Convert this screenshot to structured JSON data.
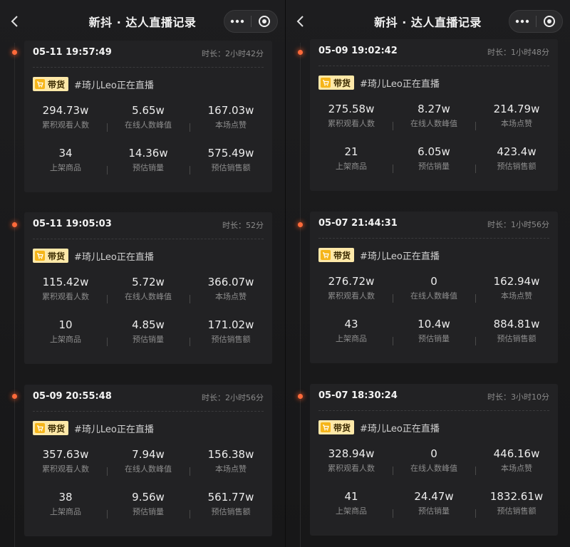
{
  "screens": [
    {
      "title": "新抖 · 达人直播记录",
      "cards": [
        {
          "time": "05-11 19:57:49",
          "duration": "时长：2小时42分",
          "tag": "带货",
          "hashtag": "#琦儿Leo正在直播",
          "stats": [
            {
              "value": "294.73w",
              "label": "累积观看人数"
            },
            {
              "value": "5.65w",
              "label": "在线人数峰值"
            },
            {
              "value": "167.03w",
              "label": "本场点赞"
            },
            {
              "value": "34",
              "label": "上架商品"
            },
            {
              "value": "14.36w",
              "label": "预估销量"
            },
            {
              "value": "575.49w",
              "label": "预估销售额"
            }
          ]
        },
        {
          "time": "05-11 19:05:03",
          "duration": "时长：52分",
          "tag": "带货",
          "hashtag": "#琦儿Leo正在直播",
          "stats": [
            {
              "value": "115.42w",
              "label": "累积观看人数"
            },
            {
              "value": "5.72w",
              "label": "在线人数峰值"
            },
            {
              "value": "366.07w",
              "label": "本场点赞"
            },
            {
              "value": "10",
              "label": "上架商品"
            },
            {
              "value": "4.85w",
              "label": "预估销量"
            },
            {
              "value": "171.02w",
              "label": "预估销售额"
            }
          ]
        },
        {
          "time": "05-09 20:55:48",
          "duration": "时长：2小时56分",
          "tag": "带货",
          "hashtag": "#琦儿Leo正在直播",
          "stats": [
            {
              "value": "357.63w",
              "label": "累积观看人数"
            },
            {
              "value": "7.94w",
              "label": "在线人数峰值"
            },
            {
              "value": "156.38w",
              "label": "本场点赞"
            },
            {
              "value": "38",
              "label": "上架商品"
            },
            {
              "value": "9.56w",
              "label": "预估销量"
            },
            {
              "value": "561.77w",
              "label": "预估销售额"
            }
          ]
        }
      ]
    },
    {
      "title": "新抖 · 达人直播记录",
      "cards": [
        {
          "time": "05-09 19:02:42",
          "duration": "时长：1小时48分",
          "tag": "带货",
          "hashtag": "#琦儿Leo正在直播",
          "stats": [
            {
              "value": "275.58w",
              "label": "累积观看人数"
            },
            {
              "value": "8.27w",
              "label": "在线人数峰值"
            },
            {
              "value": "214.79w",
              "label": "本场点赞"
            },
            {
              "value": "21",
              "label": "上架商品"
            },
            {
              "value": "6.05w",
              "label": "预估销量"
            },
            {
              "value": "423.4w",
              "label": "预估销售额"
            }
          ]
        },
        {
          "time": "05-07 21:44:31",
          "duration": "时长：1小时56分",
          "tag": "带货",
          "hashtag": "#琦儿Leo正在直播",
          "stats": [
            {
              "value": "276.72w",
              "label": "累积观看人数"
            },
            {
              "value": "0",
              "label": "在线人数峰值"
            },
            {
              "value": "162.94w",
              "label": "本场点赞"
            },
            {
              "value": "43",
              "label": "上架商品"
            },
            {
              "value": "10.4w",
              "label": "预估销量"
            },
            {
              "value": "884.81w",
              "label": "预估销售额"
            }
          ]
        },
        {
          "time": "05-07 18:30:24",
          "duration": "时长：3小时10分",
          "tag": "带货",
          "hashtag": "#琦儿Leo正在直播",
          "stats": [
            {
              "value": "328.94w",
              "label": "累积观看人数"
            },
            {
              "value": "0",
              "label": "在线人数峰值"
            },
            {
              "value": "446.16w",
              "label": "本场点赞"
            },
            {
              "value": "41",
              "label": "上架商品"
            },
            {
              "value": "24.47w",
              "label": "预估销量"
            },
            {
              "value": "1832.61w",
              "label": "预估销售额"
            }
          ]
        }
      ]
    }
  ],
  "icons": {
    "back": "chevron-left-icon",
    "more": "more-dots-icon",
    "close": "target-circle-icon",
    "tag": "shopping-cart-icon"
  },
  "colors": {
    "accent_dot": "#ff6a3a",
    "tag_bg": "#fde8a8",
    "cart": "#f5b51a"
  }
}
